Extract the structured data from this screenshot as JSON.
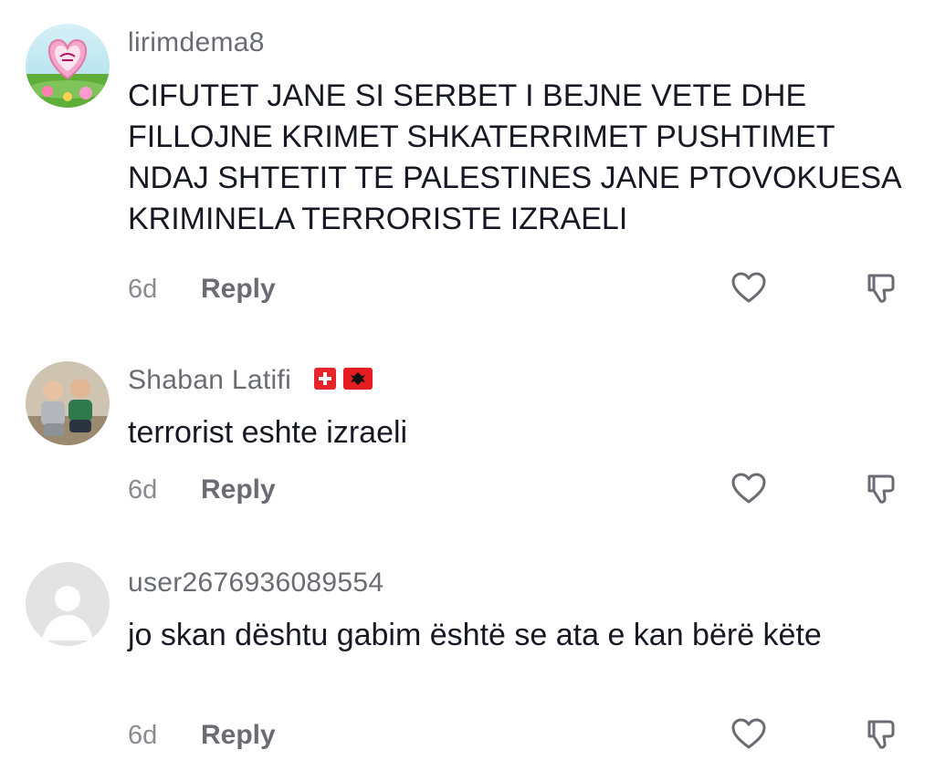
{
  "comments": [
    {
      "username": "lirimdema8",
      "text": "CIFUTET JANE SI SERBET I BEJNE VETE DHE FILLOJNE KRIMET SHKATERRIMET PUSHTIMET NDAJ SHTETIT TE PALESTINES JANE PTOVOKUESA KRIMINELA TERRORISTE IZRAELI",
      "time": "6d",
      "reply_label": "Reply",
      "avatar_icon": "allah-heart-icon",
      "flags": []
    },
    {
      "username": "Shaban Latifi",
      "text": "terrorist eshte izraeli",
      "time": "6d",
      "reply_label": "Reply",
      "avatar_icon": "photo-avatar",
      "flags": [
        "switzerland-flag-icon",
        "albania-flag-icon"
      ]
    },
    {
      "username": "user2676936089554",
      "text": "jo skan dështu gabim është se ata e kan bërë këte",
      "time": "6d",
      "reply_label": "Reply",
      "avatar_icon": "default-user-icon",
      "flags": []
    }
  ],
  "colors": {
    "username": "#6b6c73",
    "text": "#161823",
    "meta": "#8a8b91",
    "icon": "#6b6c73"
  }
}
